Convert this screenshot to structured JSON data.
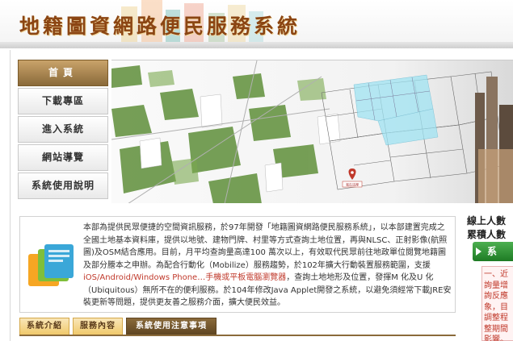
{
  "header": {
    "title": "地籍圖資網路便民服務系統"
  },
  "nav": {
    "items": [
      {
        "label": "首頁"
      },
      {
        "label": "下載專區"
      },
      {
        "label": "進入系統"
      },
      {
        "label": "網站導覽"
      },
      {
        "label": "系統使用說明"
      }
    ]
  },
  "banner": {
    "pin_label": "我在這裡"
  },
  "description": {
    "part1": "本部為提供民眾便捷的空間資訊服務，於97年開發「地籍圖資網路便民服務系統」，以本部建置完成之全國土地基本資料庫，提供以地號、建物門牌、村里等方式查詢土地位置，再與NLSC、正射影像(航照圖)及OSM結合應用。目前，月平均查詢量高達100 萬次以上，有效取代民眾前往地政單位閱覽地籍圖及部分謄本之申辦。為配合行動化（Mobilize）服務趨勢，於102年擴大行動裝置服務範圍，支援",
    "highlight": "iOS/Android/Windows Phone…手機或平板電腦瀏覽器",
    "part2": "，查詢土地地形及位置，發揮M 化及U 化（Ubiquitous）無所不在的便利服務。於104年修改Java Applet開發之系統，以避免須經常下載JRE安裝更新等問題，提供更友善之服務介面，擴大便民效益。"
  },
  "tabs": [
    {
      "label": "系統介紹"
    },
    {
      "label": "服務內容"
    },
    {
      "label": "系統使用注意事項"
    }
  ],
  "right_panel": {
    "online_label": "線上人數",
    "total_label": "累積人數",
    "button_label": "系",
    "notice_lines": [
      "一、近",
      "詢量增",
      "詢反應",
      "象，目",
      "調整程",
      "整期間",
      "影響。"
    ]
  }
}
